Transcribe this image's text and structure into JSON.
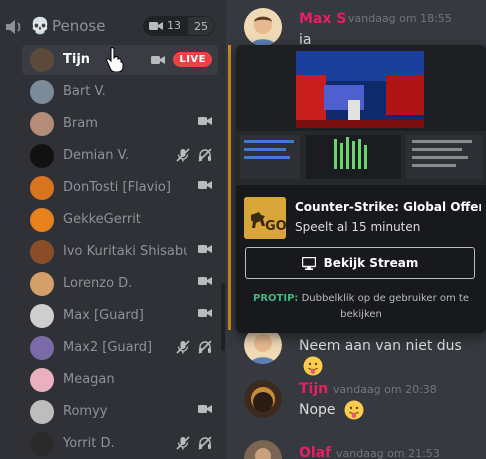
{
  "voice_channel": {
    "name": "Penose",
    "skull_glyph": "💀",
    "camera_count": "13",
    "capacity": "25"
  },
  "users": [
    {
      "name": "Tijn",
      "active": true,
      "icons": [
        "camera-icon"
      ],
      "badge": "LIVE",
      "avatar_color": "#5b4a3c"
    },
    {
      "name": "Bart V.",
      "icons": [],
      "avatar_color": "#7a8b9a"
    },
    {
      "name": "Bram",
      "icons": [
        "camera-icon"
      ],
      "avatar_color": "#b58b7a"
    },
    {
      "name": "Demian V.",
      "icons": [
        "mic-muted-icon",
        "deafen-icon"
      ],
      "avatar_color": "#111111"
    },
    {
      "name": "DonTosti [Flavio]",
      "icons": [
        "camera-icon"
      ],
      "avatar_color": "#d8751f"
    },
    {
      "name": "GekkeGerrit",
      "icons": [],
      "avatar_color": "#e8821e"
    },
    {
      "name": "Ivo Kuritaki Shisabu...",
      "icons": [
        "camera-icon"
      ],
      "avatar_color": "#8a4d2a"
    },
    {
      "name": "Lorenzo D.",
      "icons": [
        "camera-icon"
      ],
      "avatar_color": "#d4a06a"
    },
    {
      "name": "Max [Guard]",
      "icons": [
        "camera-icon"
      ],
      "avatar_color": "#cfcfcf"
    },
    {
      "name": "Max2 [Guard]",
      "icons": [
        "mic-muted-icon",
        "deafen-icon"
      ],
      "avatar_color": "#7b6aa8"
    },
    {
      "name": "Meagan",
      "icons": [],
      "avatar_color": "#e9b1c0"
    },
    {
      "name": "Romyy",
      "icons": [
        "camera-icon"
      ],
      "avatar_color": "#bdbdbd"
    },
    {
      "name": "Yorrit D.",
      "icons": [
        "mic-muted-icon",
        "deafen-icon"
      ],
      "avatar_color": "#2a2a2a"
    }
  ],
  "messages": [
    {
      "author": "Max S",
      "author_color": "#e91e63",
      "time": "vandaag om 18:55",
      "text": "ia"
    },
    {
      "author": "",
      "time": "",
      "text": "Neem aan van niet dus",
      "emoji": "smiley-tongue"
    },
    {
      "author": "Tijn",
      "author_color": "#e91e63",
      "time": "vandaag om 20:38",
      "text": "Nope",
      "emoji": "smiley-tongue"
    },
    {
      "author": "Olaf",
      "author_color": "#e91e63",
      "time": "vandaag om 21:53",
      "text": ""
    }
  ],
  "stream_popout": {
    "game_title": "Counter-Strike: Global Offen...",
    "game_subtitle": "Speelt al 15 minuten",
    "watch_button": "Bekijk Stream",
    "protip_label": "PROTIP:",
    "protip_text": "Dubbelklik op de gebruiker om te bekijken"
  }
}
